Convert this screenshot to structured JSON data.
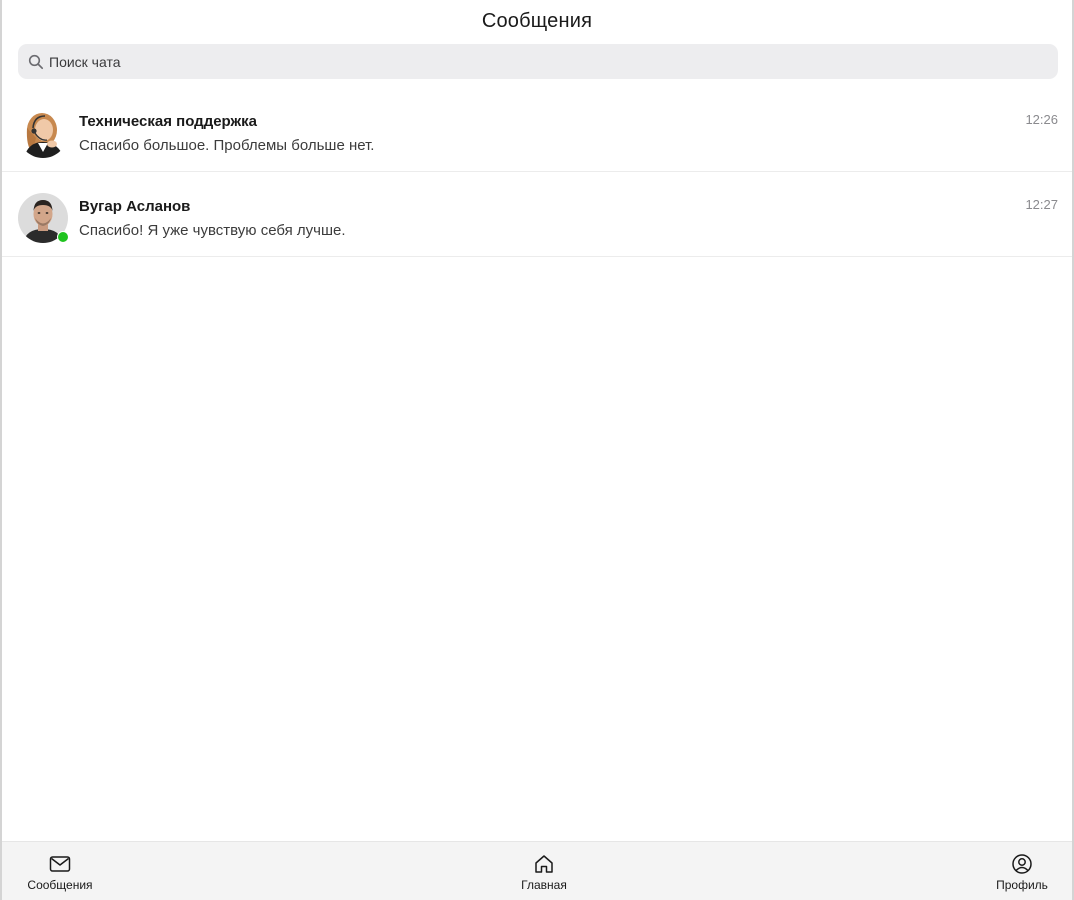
{
  "header": {
    "title": "Сообщения"
  },
  "search": {
    "placeholder": "Поиск чата",
    "icon": "search-icon"
  },
  "chats": [
    {
      "name": "Техническая поддержка",
      "preview": "Спасибо большое. Проблемы больше нет.",
      "time": "12:26",
      "avatar": "support-agent-avatar",
      "online": false
    },
    {
      "name": "Вугар Асланов",
      "preview": "Спасибо! Я уже чувствую себя лучше.",
      "time": "12:27",
      "avatar": "user-avatar",
      "online": true
    }
  ],
  "tabbar": {
    "items": [
      {
        "label": "Сообщения",
        "icon": "envelope-icon"
      },
      {
        "label": "Главная",
        "icon": "home-icon"
      },
      {
        "label": "Профиль",
        "icon": "profile-icon"
      }
    ]
  },
  "colors": {
    "online": "#1fc31f",
    "search_bg": "#ededef",
    "tabbar_bg": "#f4f4f4"
  }
}
